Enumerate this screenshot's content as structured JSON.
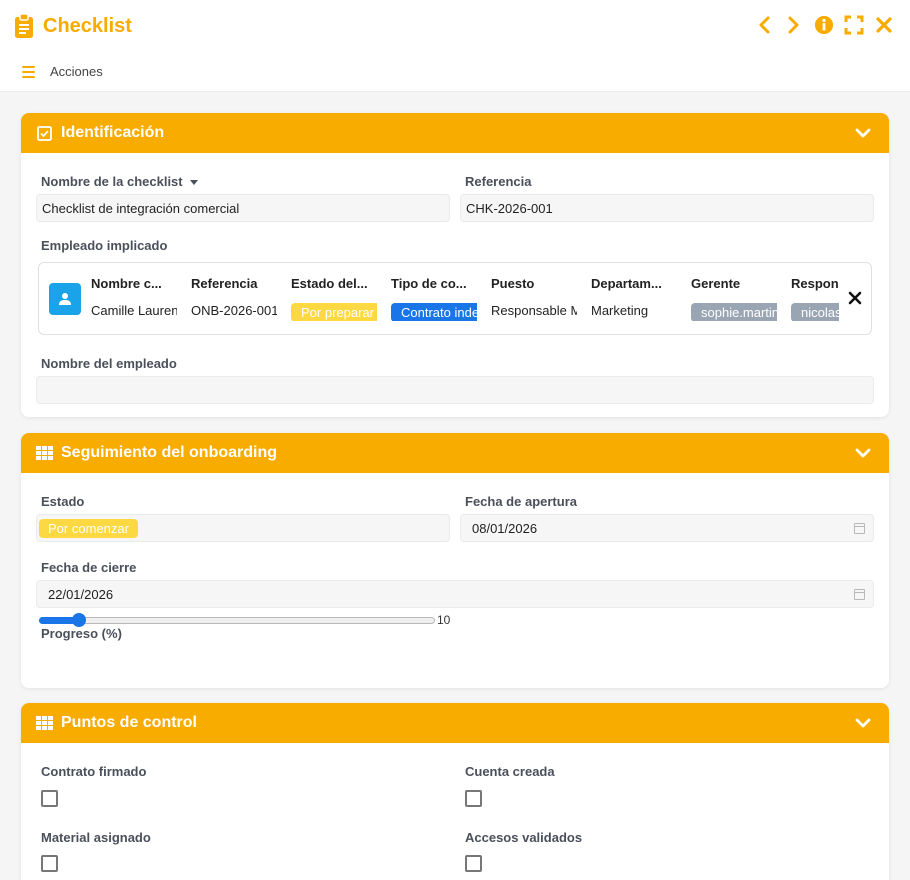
{
  "app": {
    "title": "Checklist",
    "actions_label": "Acciones"
  },
  "colors": {
    "accent": "#f9ac00",
    "link_blue": "#1a75e8",
    "avatar_blue": "#1aa3e8",
    "pill_yellow": "#fcd843",
    "pill_gray": "#9aa5b4"
  },
  "identificacion": {
    "title": "Identificación",
    "name_label": "Nombre de la checklist",
    "name_value": "Checklist de integración comercial",
    "ref_label": "Referencia",
    "ref_value": "CHK-2026-001",
    "employee_label": "Empleado implicado",
    "employee": {
      "columns": [
        {
          "header": "Nombre c...",
          "value": "Camille Laurent"
        },
        {
          "header": "Referencia",
          "value": "ONB-2026-001"
        },
        {
          "header": "Estado del...",
          "value": "Por preparar"
        },
        {
          "header": "Tipo de co...",
          "value": "Contrato indefinido"
        },
        {
          "header": "Puesto",
          "value": "Responsable Marketing"
        },
        {
          "header": "Departam...",
          "value": "Marketing"
        },
        {
          "header": "Gerente",
          "value": "sophie.martin"
        },
        {
          "header": "Respon",
          "value": "nicolas"
        }
      ]
    },
    "employee_name_label": "Nombre del empleado",
    "employee_name_value": ""
  },
  "seguimiento": {
    "title": "Seguimiento del onboarding",
    "estado_label": "Estado",
    "estado_value": "Por comenzar",
    "apertura_label": "Fecha de apertura",
    "apertura_value": "08/01/2026",
    "cierre_label": "Fecha de cierre",
    "cierre_value": "22/01/2026",
    "progreso_label": "Progreso (%)",
    "progreso_value": 10,
    "progreso_display": "10"
  },
  "puntos": {
    "title": "Puntos de control",
    "items": [
      {
        "label": "Contrato firmado",
        "checked": false
      },
      {
        "label": "Cuenta creada",
        "checked": false
      },
      {
        "label": "Material asignado",
        "checked": false
      },
      {
        "label": "Accesos validados",
        "checked": false
      }
    ]
  },
  "icons": {
    "title": "clipboard-icon",
    "prev": "chevron-left-icon",
    "next": "chevron-right-icon",
    "info": "info-icon",
    "fullscreen": "expand-icon",
    "close": "close-icon",
    "menu": "hamburger-icon",
    "section1": "checkbox-icon",
    "section2": "grid-icon",
    "section3": "grid-icon",
    "collapse": "chevron-down-icon",
    "avatar": "user-icon",
    "calendar": "calendar-icon",
    "remove": "close-icon"
  }
}
